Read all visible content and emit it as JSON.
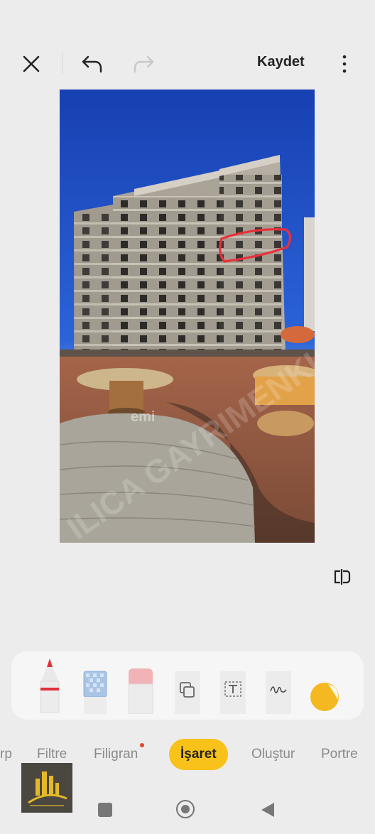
{
  "header": {
    "save_label": "Kaydet",
    "close_icon": "close-icon",
    "undo_icon": "undo-icon",
    "redo_icon": "redo-icon",
    "more_icon": "more-vertical-icon"
  },
  "photo": {
    "watermark_text": "ILICA GAYRIMENKUL",
    "overlay_text": "emi"
  },
  "compare_icon": "compare-icon",
  "tools": [
    {
      "name": "pen",
      "icon": "pen-icon"
    },
    {
      "name": "mosaic",
      "icon": "mosaic-icon"
    },
    {
      "name": "eraser",
      "icon": "eraser-icon"
    },
    {
      "name": "shape",
      "icon": "shape-icon"
    },
    {
      "name": "text",
      "icon": "text-icon"
    },
    {
      "name": "signature",
      "icon": "signature-icon"
    },
    {
      "name": "sticker",
      "icon": "sticker-icon"
    }
  ],
  "tabs": {
    "crop_partial": "rp",
    "filter": "Filtre",
    "watermark": "Filigran",
    "markup": "İşaret",
    "create": "Oluştur",
    "portrait": "Portre"
  },
  "colors": {
    "accent": "#f8c21a",
    "markup_circle": "#e8303a",
    "notification_dot": "#e0462c"
  }
}
